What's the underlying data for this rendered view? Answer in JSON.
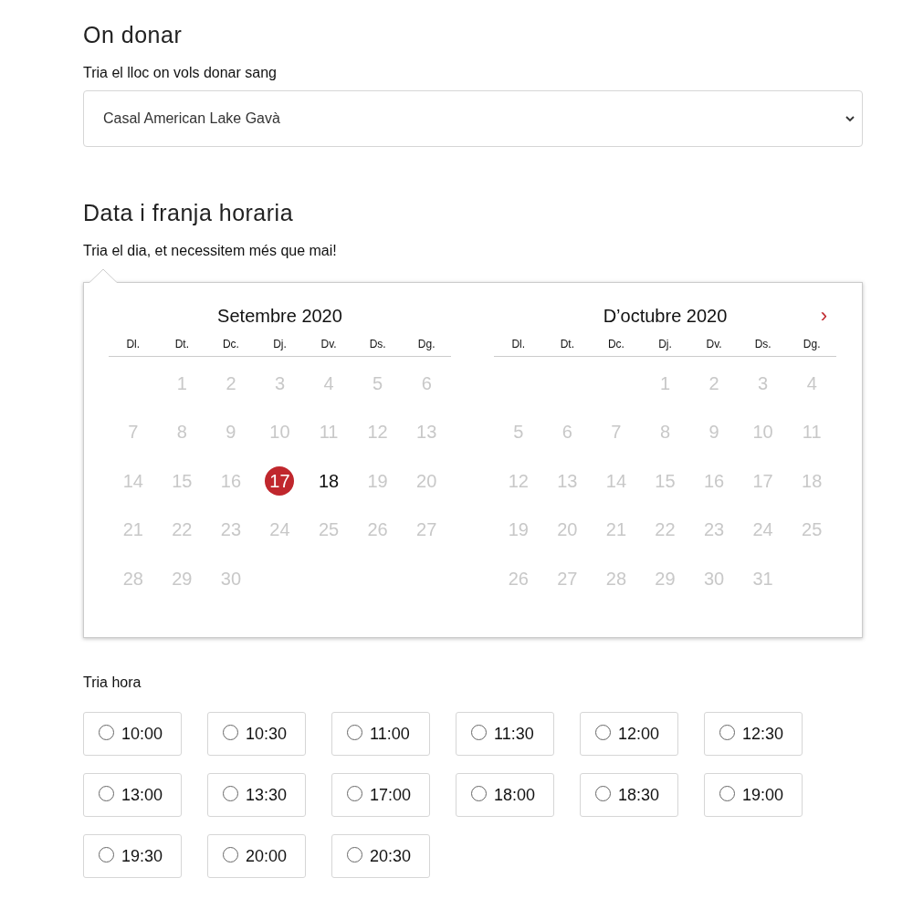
{
  "location_section": {
    "heading": "On donar",
    "label": "Tria el lloc on vols donar sang",
    "select_value": "Casal American Lake Gavà"
  },
  "date_section": {
    "heading": "Data i franja horaria",
    "label": "Tria el dia, et necessitem més que mai!",
    "calendar": {
      "next_button": "›",
      "months": [
        {
          "title": "Setembre 2020",
          "weekdays": [
            "Dl.",
            "Dt.",
            "Dc.",
            "Dj.",
            "Dv.",
            "Ds.",
            "Dg."
          ],
          "weeks": [
            {
              "kind": "leading",
              "days": [
                {
                  "day": "1",
                  "available": false,
                  "selected": false
                },
                {
                  "day": "2",
                  "available": false,
                  "selected": false
                },
                {
                  "day": "3",
                  "available": false,
                  "selected": false
                },
                {
                  "day": "4",
                  "available": false,
                  "selected": false
                },
                {
                  "day": "5",
                  "available": false,
                  "selected": false
                },
                {
                  "day": "6",
                  "available": false,
                  "selected": false
                }
              ]
            },
            {
              "kind": "regular",
              "days": [
                {
                  "day": "7",
                  "available": false,
                  "selected": false
                },
                {
                  "day": "8",
                  "available": false,
                  "selected": false
                },
                {
                  "day": "9",
                  "available": false,
                  "selected": false
                },
                {
                  "day": "10",
                  "available": false,
                  "selected": false
                },
                {
                  "day": "11",
                  "available": false,
                  "selected": false
                },
                {
                  "day": "12",
                  "available": false,
                  "selected": false
                },
                {
                  "day": "13",
                  "available": false,
                  "selected": false
                }
              ]
            },
            {
              "kind": "regular",
              "days": [
                {
                  "day": "14",
                  "available": false,
                  "selected": false
                },
                {
                  "day": "15",
                  "available": false,
                  "selected": false
                },
                {
                  "day": "16",
                  "available": false,
                  "selected": false
                },
                {
                  "day": "17",
                  "available": true,
                  "selected": true
                },
                {
                  "day": "18",
                  "available": true,
                  "selected": false
                },
                {
                  "day": "19",
                  "available": false,
                  "selected": false
                },
                {
                  "day": "20",
                  "available": false,
                  "selected": false
                }
              ]
            },
            {
              "kind": "regular",
              "days": [
                {
                  "day": "21",
                  "available": false,
                  "selected": false
                },
                {
                  "day": "22",
                  "available": false,
                  "selected": false
                },
                {
                  "day": "23",
                  "available": false,
                  "selected": false
                },
                {
                  "day": "24",
                  "available": false,
                  "selected": false
                },
                {
                  "day": "25",
                  "available": false,
                  "selected": false
                },
                {
                  "day": "26",
                  "available": false,
                  "selected": false
                },
                {
                  "day": "27",
                  "available": false,
                  "selected": false
                }
              ]
            },
            {
              "kind": "regular",
              "days": [
                {
                  "day": "28",
                  "available": false,
                  "selected": false
                },
                {
                  "day": "29",
                  "available": false,
                  "selected": false
                },
                {
                  "day": "30",
                  "available": false,
                  "selected": false
                }
              ]
            }
          ]
        },
        {
          "title": "D’octubre 2020",
          "weekdays": [
            "Dl.",
            "Dt.",
            "Dc.",
            "Dj.",
            "Dv.",
            "Ds.",
            "Dg."
          ],
          "weeks": [
            {
              "kind": "leading",
              "days": [
                {
                  "day": "1",
                  "available": false,
                  "selected": false
                },
                {
                  "day": "2",
                  "available": false,
                  "selected": false
                },
                {
                  "day": "3",
                  "available": false,
                  "selected": false
                },
                {
                  "day": "4",
                  "available": false,
                  "selected": false
                }
              ]
            },
            {
              "kind": "regular",
              "days": [
                {
                  "day": "5",
                  "available": false,
                  "selected": false
                },
                {
                  "day": "6",
                  "available": false,
                  "selected": false
                },
                {
                  "day": "7",
                  "available": false,
                  "selected": false
                },
                {
                  "day": "8",
                  "available": false,
                  "selected": false
                },
                {
                  "day": "9",
                  "available": false,
                  "selected": false
                },
                {
                  "day": "10",
                  "available": false,
                  "selected": false
                },
                {
                  "day": "11",
                  "available": false,
                  "selected": false
                }
              ]
            },
            {
              "kind": "regular",
              "days": [
                {
                  "day": "12",
                  "available": false,
                  "selected": false
                },
                {
                  "day": "13",
                  "available": false,
                  "selected": false
                },
                {
                  "day": "14",
                  "available": false,
                  "selected": false
                },
                {
                  "day": "15",
                  "available": false,
                  "selected": false
                },
                {
                  "day": "16",
                  "available": false,
                  "selected": false
                },
                {
                  "day": "17",
                  "available": false,
                  "selected": false
                },
                {
                  "day": "18",
                  "available": false,
                  "selected": false
                }
              ]
            },
            {
              "kind": "regular",
              "days": [
                {
                  "day": "19",
                  "available": false,
                  "selected": false
                },
                {
                  "day": "20",
                  "available": false,
                  "selected": false
                },
                {
                  "day": "21",
                  "available": false,
                  "selected": false
                },
                {
                  "day": "22",
                  "available": false,
                  "selected": false
                },
                {
                  "day": "23",
                  "available": false,
                  "selected": false
                },
                {
                  "day": "24",
                  "available": false,
                  "selected": false
                },
                {
                  "day": "25",
                  "available": false,
                  "selected": false
                }
              ]
            },
            {
              "kind": "regular",
              "days": [
                {
                  "day": "26",
                  "available": false,
                  "selected": false
                },
                {
                  "day": "27",
                  "available": false,
                  "selected": false
                },
                {
                  "day": "28",
                  "available": false,
                  "selected": false
                },
                {
                  "day": "29",
                  "available": false,
                  "selected": false
                },
                {
                  "day": "30",
                  "available": false,
                  "selected": false
                },
                {
                  "day": "31",
                  "available": false,
                  "selected": false
                }
              ]
            }
          ]
        }
      ]
    }
  },
  "time_section": {
    "label": "Tria hora",
    "slots": [
      {
        "time": "10:00",
        "selected": false
      },
      {
        "time": "10:30",
        "selected": false
      },
      {
        "time": "11:00",
        "selected": false
      },
      {
        "time": "11:30",
        "selected": false
      },
      {
        "time": "12:00",
        "selected": false
      },
      {
        "time": "12:30",
        "selected": false
      },
      {
        "time": "13:00",
        "selected": false
      },
      {
        "time": "13:30",
        "selected": false
      },
      {
        "time": "17:00",
        "selected": false
      },
      {
        "time": "18:00",
        "selected": false
      },
      {
        "time": "18:30",
        "selected": false
      },
      {
        "time": "19:00",
        "selected": false
      },
      {
        "time": "19:30",
        "selected": false
      },
      {
        "time": "20:00",
        "selected": false
      },
      {
        "time": "20:30",
        "selected": false
      }
    ]
  }
}
